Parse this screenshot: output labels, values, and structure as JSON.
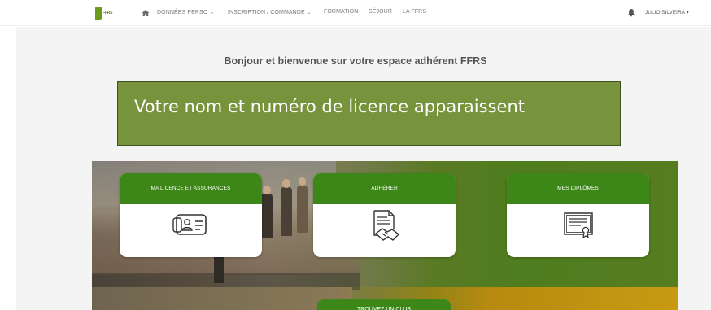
{
  "header": {
    "logo_text": "FFRS",
    "nav": [
      {
        "label": "DONNÉES PERSO",
        "has_caret": true
      },
      {
        "label": "INSCRIPTION / COMMANDE",
        "has_caret": true
      },
      {
        "label": "FORMATION",
        "has_caret": false
      },
      {
        "label": "SÉJOUR",
        "has_caret": false
      },
      {
        "label": "LA FFRS",
        "has_caret": false
      }
    ],
    "user_name": "JULIO SILVEIRA ▾",
    "icons": [
      "home-icon",
      "bell-icon"
    ]
  },
  "main": {
    "welcome": "Bonjour et bienvenue sur votre espace adhérent FFRS",
    "annotation": "Votre nom et numéro de licence apparaissent"
  },
  "cards": [
    {
      "title": "MA LICENCE ET ASSURANCES",
      "icon": "id-card-icon"
    },
    {
      "title": "ADHÉRER",
      "icon": "contract-handshake-icon"
    },
    {
      "title": "MES DIPLÔMES",
      "icon": "certificate-icon"
    }
  ],
  "club_button": "TROUVEZ UN CLUB",
  "colors": {
    "brand_green": "#3c8717",
    "annotation_green": "#77933c",
    "page_bg": "#f4f4f4"
  }
}
